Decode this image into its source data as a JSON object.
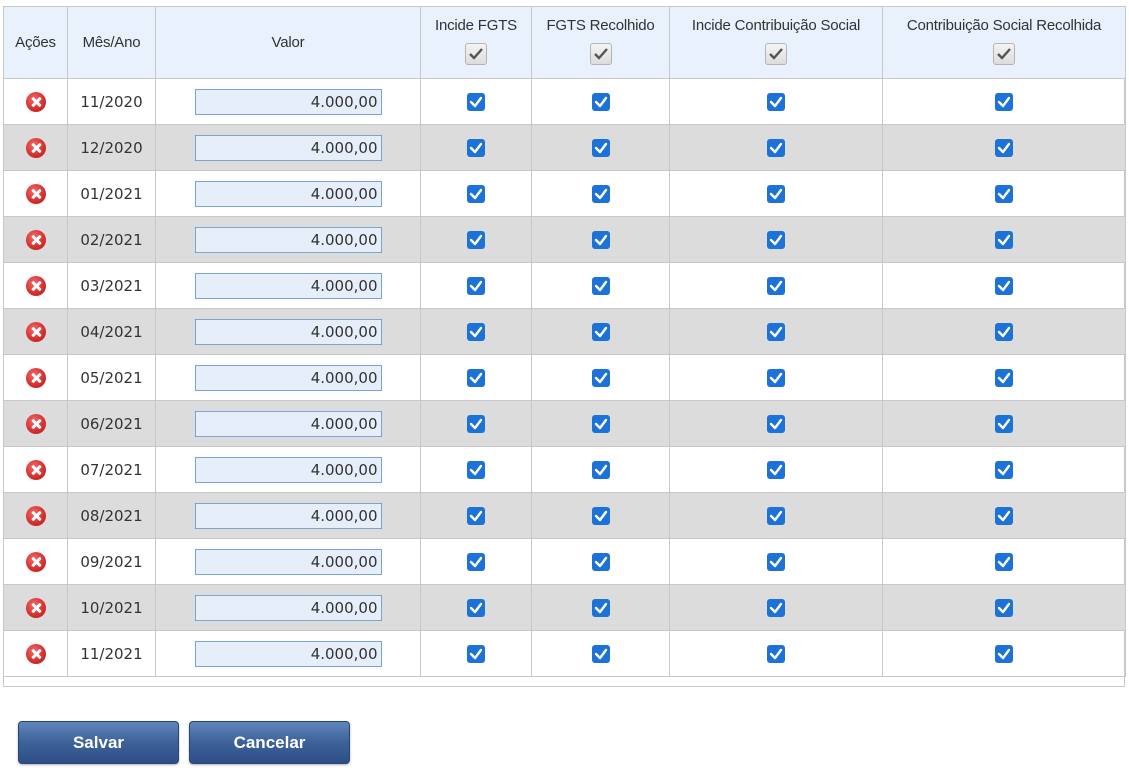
{
  "table": {
    "headers": {
      "acoes": "Ações",
      "mes_ano": "Mês/Ano",
      "valor": "Valor",
      "incide_fgts": "Incide FGTS",
      "fgts_recolhido": "FGTS Recolhido",
      "incide_contribuicao": "Incide Contribuição Social",
      "contribuicao_recolhida": "Contribuição Social Recolhida"
    },
    "header_checks": {
      "incide_fgts": true,
      "fgts_recolhido": true,
      "incide_contribuicao": true,
      "contribuicao_recolhida": true
    },
    "rows": [
      {
        "mes_ano": "11/2020",
        "valor": "4.000,00",
        "incide_fgts": true,
        "fgts_recolhido": true,
        "incide_contribuicao": true,
        "contribuicao_recolhida": true
      },
      {
        "mes_ano": "12/2020",
        "valor": "4.000,00",
        "incide_fgts": true,
        "fgts_recolhido": true,
        "incide_contribuicao": true,
        "contribuicao_recolhida": true
      },
      {
        "mes_ano": "01/2021",
        "valor": "4.000,00",
        "incide_fgts": true,
        "fgts_recolhido": true,
        "incide_contribuicao": true,
        "contribuicao_recolhida": true
      },
      {
        "mes_ano": "02/2021",
        "valor": "4.000,00",
        "incide_fgts": true,
        "fgts_recolhido": true,
        "incide_contribuicao": true,
        "contribuicao_recolhida": true
      },
      {
        "mes_ano": "03/2021",
        "valor": "4.000,00",
        "incide_fgts": true,
        "fgts_recolhido": true,
        "incide_contribuicao": true,
        "contribuicao_recolhida": true
      },
      {
        "mes_ano": "04/2021",
        "valor": "4.000,00",
        "incide_fgts": true,
        "fgts_recolhido": true,
        "incide_contribuicao": true,
        "contribuicao_recolhida": true
      },
      {
        "mes_ano": "05/2021",
        "valor": "4.000,00",
        "incide_fgts": true,
        "fgts_recolhido": true,
        "incide_contribuicao": true,
        "contribuicao_recolhida": true
      },
      {
        "mes_ano": "06/2021",
        "valor": "4.000,00",
        "incide_fgts": true,
        "fgts_recolhido": true,
        "incide_contribuicao": true,
        "contribuicao_recolhida": true
      },
      {
        "mes_ano": "07/2021",
        "valor": "4.000,00",
        "incide_fgts": true,
        "fgts_recolhido": true,
        "incide_contribuicao": true,
        "contribuicao_recolhida": true
      },
      {
        "mes_ano": "08/2021",
        "valor": "4.000,00",
        "incide_fgts": true,
        "fgts_recolhido": true,
        "incide_contribuicao": true,
        "contribuicao_recolhida": true
      },
      {
        "mes_ano": "09/2021",
        "valor": "4.000,00",
        "incide_fgts": true,
        "fgts_recolhido": true,
        "incide_contribuicao": true,
        "contribuicao_recolhida": true
      },
      {
        "mes_ano": "10/2021",
        "valor": "4.000,00",
        "incide_fgts": true,
        "fgts_recolhido": true,
        "incide_contribuicao": true,
        "contribuicao_recolhida": true
      },
      {
        "mes_ano": "11/2021",
        "valor": "4.000,00",
        "incide_fgts": true,
        "fgts_recolhido": true,
        "incide_contribuicao": true,
        "contribuicao_recolhida": true
      }
    ],
    "row_action_icon": "remove-circle-icon"
  },
  "buttons": {
    "save_label": "Salvar",
    "cancel_label": "Cancelar"
  },
  "colors": {
    "header_bg": "#e8f1fc",
    "alt_row_bg": "#dcdcdc",
    "checkbox_blue": "#1d72d8",
    "delete_red": "#d32d2d",
    "button_blue": "#3d6199"
  }
}
